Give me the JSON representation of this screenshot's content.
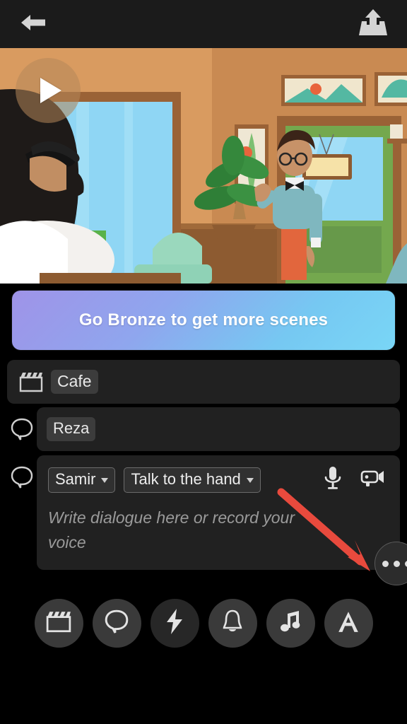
{
  "header": {
    "back_icon": "back-arrow-icon",
    "share_icon": "upload-share-icon"
  },
  "preview": {
    "play_icon": "play-icon",
    "scene_description": "Animated cafe interior with two characters, framed wall art, a green door, a potted plant and teal armchairs"
  },
  "promo": {
    "label": "Go Bronze to get more scenes",
    "gradient_from": "#9f93e8",
    "gradient_to": "#79d6f6",
    "text_color": "#ffffff"
  },
  "rows": {
    "scene": {
      "icon": "clapperboard-icon",
      "value": "Cafe"
    },
    "character": {
      "icon": "speech-bubble-icon",
      "value": "Reza"
    },
    "dialogue": {
      "icon": "speech-bubble-icon",
      "speaker": "Samir",
      "action": "Talk to the hand",
      "caret": "▾",
      "mic_icon": "microphone-icon",
      "camera_icon": "video-camera-icon",
      "placeholder": "Write dialogue here or record your voice",
      "more_icon": "more-options-icon"
    }
  },
  "annotation": {
    "type": "arrow",
    "color": "#e84a3d",
    "points_to": "more-options-button"
  },
  "toolbar": {
    "items": [
      {
        "name": "scene",
        "icon": "clapperboard-icon",
        "dim": false
      },
      {
        "name": "dialogue",
        "icon": "speech-bubble-icon",
        "dim": false
      },
      {
        "name": "action",
        "icon": "lightning-bolt-icon",
        "dim": true
      },
      {
        "name": "sound",
        "icon": "bell-icon",
        "dim": false
      },
      {
        "name": "music",
        "icon": "music-note-icon",
        "dim": false
      },
      {
        "name": "text",
        "icon": "text-a-icon",
        "dim": false
      }
    ]
  },
  "colors": {
    "background": "#000000",
    "panel": "#212121",
    "topbar": "#1b1b1b",
    "chip": "#3c3c3c",
    "icon": "#d8d8d8"
  }
}
